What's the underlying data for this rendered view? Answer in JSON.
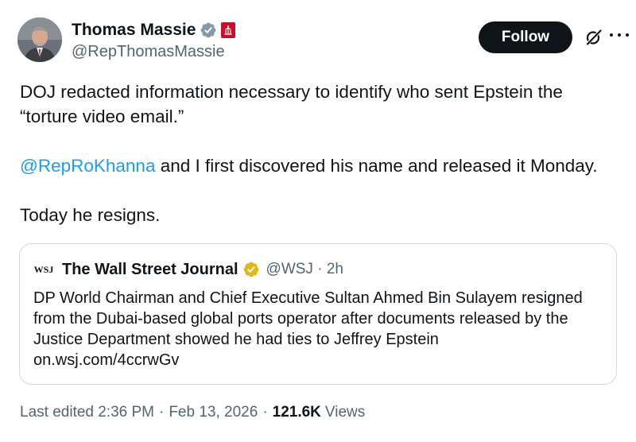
{
  "author": {
    "name": "Thomas Massie",
    "handle": "@RepThomasMassie"
  },
  "follow_label": "Follow",
  "tweet": {
    "line1": "DOJ redacted information necessary to identify who sent Epstein the",
    "line2": "“torture video email.”",
    "mention": "@RepRoKhanna",
    "line3_rest": " and I first discovered his name and released it Monday.",
    "line4": "Today he resigns."
  },
  "quote": {
    "logo_text": "WSJ",
    "name": "The Wall Street Journal",
    "handle": "@WSJ",
    "time": "2h",
    "text": "DP World Chairman and Chief Executive Sultan Ahmed Bin Sulayem resigned from the Dubai-based global ports operator after documents released by the Justice Department showed he had ties to Jeffrey Epstein",
    "link": "on.wsj.com/4ccrwGv"
  },
  "footer": {
    "edited": "Last edited 2:36 PM",
    "date": "Feb 13, 2026",
    "views_count": "121.6K",
    "views_label": "Views"
  },
  "colors": {
    "accent": "#1d9bf0",
    "secondary_text": "#536471",
    "verified_blue": "#1d9bf0",
    "verified_gold": "#e2b719",
    "government_badge": "#c8102e"
  },
  "icons": {
    "verified": "verified-badge-icon",
    "affiliation": "house-affiliation-icon",
    "grok": "grok-icon",
    "more": "more-icon"
  }
}
